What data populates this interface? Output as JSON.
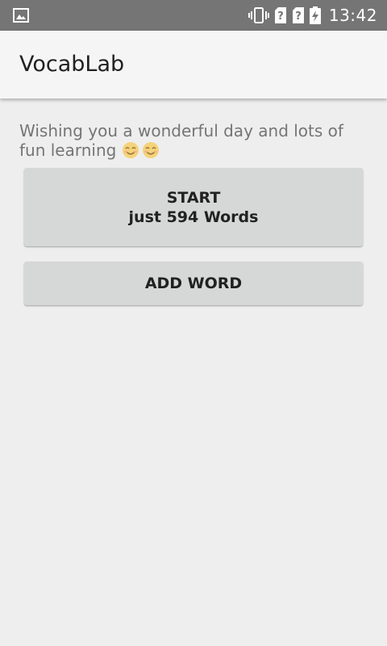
{
  "status_bar": {
    "time": "13:42",
    "icons": [
      "image-icon",
      "vibrate-icon",
      "sim-unknown-icon",
      "sim-unknown-icon",
      "battery-charging-icon"
    ]
  },
  "app_bar": {
    "title": "VocabLab"
  },
  "main": {
    "greeting": "Wishing you a wonderful day and lots of fun learning",
    "start_button": {
      "label": "START",
      "sublabel": "just 594 Words"
    },
    "add_word_button": {
      "label": "ADD WORD"
    }
  },
  "colors": {
    "status_bar": "#757575",
    "app_bar": "#f5f5f5",
    "background": "#eeeeee",
    "button": "#d6d7d7",
    "greeting_text": "#757575"
  }
}
